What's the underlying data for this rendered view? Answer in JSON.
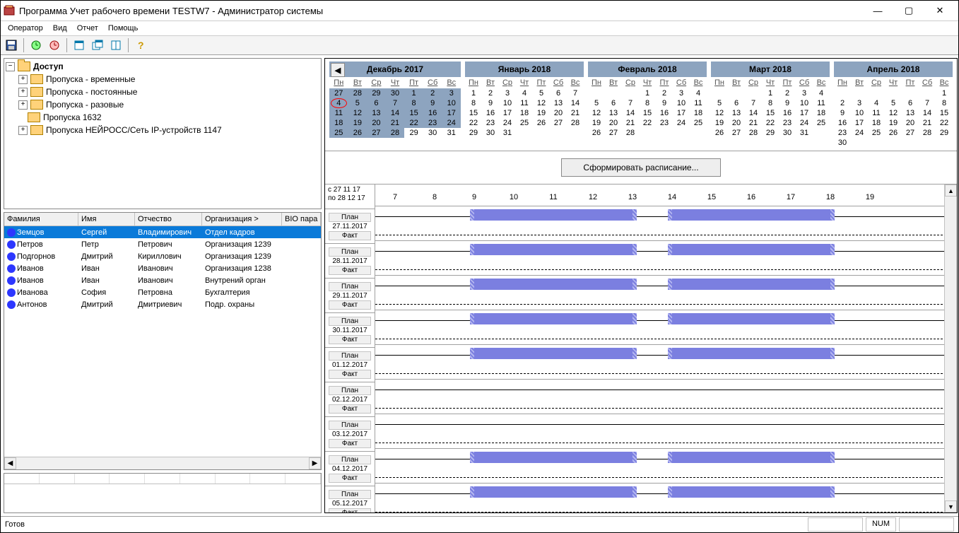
{
  "window": {
    "title": "Программа Учет рабочего времени TESTW7 - Администратор системы"
  },
  "menu": {
    "items": [
      "Оператор",
      "Вид",
      "Отчет",
      "Помощь"
    ]
  },
  "tree": {
    "root": "Доступ",
    "items": [
      "Пропуска - временные",
      "Пропуска - постоянные",
      "Пропуска - разовые",
      "Пропуска 1632",
      "Пропуска НЕЙРОСС/Сеть IP-устройств 1147"
    ]
  },
  "emp_table": {
    "cols": {
      "surname": "Фамилия",
      "name": "Имя",
      "patr": "Отчество",
      "org": "Организация >",
      "bio": "BIO пара"
    },
    "rows": [
      {
        "s": "Земцов",
        "n": "Сергей",
        "p": "Владимирович",
        "o": "Отдел кадров",
        "sel": true
      },
      {
        "s": "Петров",
        "n": "Петр",
        "p": "Петрович",
        "o": "Организация 1239"
      },
      {
        "s": "Подгорнов",
        "n": "Дмитрий",
        "p": "Кириллович",
        "o": "Организация 1239"
      },
      {
        "s": "Иванов",
        "n": "Иван",
        "p": "Иванович",
        "o": "Организация 1238"
      },
      {
        "s": "Иванов",
        "n": "Иван",
        "p": "Иванович",
        "o": "Внутрений орган"
      },
      {
        "s": "Иванова",
        "n": "София",
        "p": "Петровна",
        "o": "Бухгалтерия"
      },
      {
        "s": "Антонов",
        "n": "Дмитрий",
        "p": "Дмитриевич",
        "o": "Подр. охраны"
      }
    ]
  },
  "dow": [
    "Пн",
    "Вт",
    "Ср",
    "Чт",
    "Пт",
    "Сб",
    "Вс"
  ],
  "calendars": [
    {
      "title": "Декабрь 2017",
      "first": true,
      "weeks": [
        [
          {
            "d": 27,
            "s": 1
          },
          {
            "d": 28,
            "s": 1
          },
          {
            "d": 29,
            "s": 1
          },
          {
            "d": 30,
            "s": 1
          },
          {
            "d": 1,
            "s": 1
          },
          {
            "d": 2,
            "s": 1
          },
          {
            "d": 3,
            "s": 1
          }
        ],
        [
          {
            "d": 4,
            "s": 1,
            "t": 1
          },
          {
            "d": 5,
            "s": 1
          },
          {
            "d": 6,
            "s": 1
          },
          {
            "d": 7,
            "s": 1
          },
          {
            "d": 8,
            "s": 1
          },
          {
            "d": 9,
            "s": 1
          },
          {
            "d": 10,
            "s": 1
          }
        ],
        [
          {
            "d": 11,
            "s": 1
          },
          {
            "d": 12,
            "s": 1
          },
          {
            "d": 13,
            "s": 1
          },
          {
            "d": 14,
            "s": 1
          },
          {
            "d": 15,
            "s": 1
          },
          {
            "d": 16,
            "s": 1
          },
          {
            "d": 17,
            "s": 1
          }
        ],
        [
          {
            "d": 18,
            "s": 1
          },
          {
            "d": 19,
            "s": 1
          },
          {
            "d": 20,
            "s": 1
          },
          {
            "d": 21,
            "s": 1
          },
          {
            "d": 22,
            "s": 1
          },
          {
            "d": 23,
            "s": 1
          },
          {
            "d": 24,
            "s": 1
          }
        ],
        [
          {
            "d": 25,
            "s": 1
          },
          {
            "d": 26,
            "s": 1
          },
          {
            "d": 27,
            "s": 1
          },
          {
            "d": 28,
            "s": 1
          },
          {
            "d": 29
          },
          {
            "d": 30
          },
          {
            "d": 31
          }
        ]
      ]
    },
    {
      "title": "Январь 2018",
      "weeks": [
        [
          {
            "d": 1
          },
          {
            "d": 2
          },
          {
            "d": 3
          },
          {
            "d": 4
          },
          {
            "d": 5
          },
          {
            "d": 6
          },
          {
            "d": 7
          }
        ],
        [
          {
            "d": 8
          },
          {
            "d": 9
          },
          {
            "d": 10
          },
          {
            "d": 11
          },
          {
            "d": 12
          },
          {
            "d": 13
          },
          {
            "d": 14
          }
        ],
        [
          {
            "d": 15
          },
          {
            "d": 16
          },
          {
            "d": 17
          },
          {
            "d": 18
          },
          {
            "d": 19
          },
          {
            "d": 20
          },
          {
            "d": 21
          }
        ],
        [
          {
            "d": 22
          },
          {
            "d": 23
          },
          {
            "d": 24
          },
          {
            "d": 25
          },
          {
            "d": 26
          },
          {
            "d": 27
          },
          {
            "d": 28
          }
        ],
        [
          {
            "d": 29
          },
          {
            "d": 30
          },
          {
            "d": 31
          },
          {
            "d": ""
          },
          {
            "d": ""
          },
          {
            "d": ""
          },
          {
            "d": ""
          }
        ]
      ]
    },
    {
      "title": "Февраль 2018",
      "weeks": [
        [
          {
            "d": ""
          },
          {
            "d": ""
          },
          {
            "d": ""
          },
          {
            "d": 1
          },
          {
            "d": 2
          },
          {
            "d": 3
          },
          {
            "d": 4
          }
        ],
        [
          {
            "d": 5
          },
          {
            "d": 6
          },
          {
            "d": 7
          },
          {
            "d": 8
          },
          {
            "d": 9
          },
          {
            "d": 10
          },
          {
            "d": 11
          }
        ],
        [
          {
            "d": 12
          },
          {
            "d": 13
          },
          {
            "d": 14
          },
          {
            "d": 15
          },
          {
            "d": 16
          },
          {
            "d": 17
          },
          {
            "d": 18
          }
        ],
        [
          {
            "d": 19
          },
          {
            "d": 20
          },
          {
            "d": 21
          },
          {
            "d": 22
          },
          {
            "d": 23
          },
          {
            "d": 24
          },
          {
            "d": 25
          }
        ],
        [
          {
            "d": 26
          },
          {
            "d": 27
          },
          {
            "d": 28
          },
          {
            "d": ""
          },
          {
            "d": ""
          },
          {
            "d": ""
          },
          {
            "d": ""
          }
        ]
      ]
    },
    {
      "title": "Март 2018",
      "weeks": [
        [
          {
            "d": ""
          },
          {
            "d": ""
          },
          {
            "d": ""
          },
          {
            "d": 1
          },
          {
            "d": 2
          },
          {
            "d": 3
          },
          {
            "d": 4
          }
        ],
        [
          {
            "d": 5
          },
          {
            "d": 6
          },
          {
            "d": 7
          },
          {
            "d": 8
          },
          {
            "d": 9
          },
          {
            "d": 10
          },
          {
            "d": 11
          }
        ],
        [
          {
            "d": 12
          },
          {
            "d": 13
          },
          {
            "d": 14
          },
          {
            "d": 15
          },
          {
            "d": 16
          },
          {
            "d": 17
          },
          {
            "d": 18
          }
        ],
        [
          {
            "d": 19
          },
          {
            "d": 20
          },
          {
            "d": 21
          },
          {
            "d": 22
          },
          {
            "d": 23
          },
          {
            "d": 24
          },
          {
            "d": 25
          }
        ],
        [
          {
            "d": 26
          },
          {
            "d": 27
          },
          {
            "d": 28
          },
          {
            "d": 29
          },
          {
            "d": 30
          },
          {
            "d": 31
          },
          {
            "d": ""
          }
        ]
      ]
    },
    {
      "title": "Апрель 2018",
      "weeks": [
        [
          {
            "d": ""
          },
          {
            "d": ""
          },
          {
            "d": ""
          },
          {
            "d": ""
          },
          {
            "d": ""
          },
          {
            "d": ""
          },
          {
            "d": 1
          }
        ],
        [
          {
            "d": 2
          },
          {
            "d": 3
          },
          {
            "d": 4
          },
          {
            "d": 5
          },
          {
            "d": 6
          },
          {
            "d": 7
          },
          {
            "d": 8
          }
        ],
        [
          {
            "d": 9
          },
          {
            "d": 10
          },
          {
            "d": 11
          },
          {
            "d": 12
          },
          {
            "d": 13
          },
          {
            "d": 14
          },
          {
            "d": 15
          }
        ],
        [
          {
            "d": 16
          },
          {
            "d": 17
          },
          {
            "d": 18
          },
          {
            "d": 19
          },
          {
            "d": 20
          },
          {
            "d": 21
          },
          {
            "d": 22
          }
        ],
        [
          {
            "d": 23
          },
          {
            "d": 24
          },
          {
            "d": 25
          },
          {
            "d": 26
          },
          {
            "d": 27
          },
          {
            "d": 28
          },
          {
            "d": 29
          }
        ],
        [
          {
            "d": 30
          },
          {
            "d": ""
          },
          {
            "d": ""
          },
          {
            "d": ""
          },
          {
            "d": ""
          },
          {
            "d": ""
          },
          {
            "d": ""
          }
        ]
      ]
    }
  ],
  "generate_btn": "Сформировать расписание...",
  "schedule": {
    "range1": "с 27 11 17",
    "range2": "по 28 12 17",
    "hours": [
      7,
      8,
      9,
      10,
      11,
      12,
      13,
      14,
      15,
      16,
      17,
      18,
      19
    ],
    "plan_label": "План",
    "fact_label": "Факт",
    "days": [
      {
        "date": "27.11.2017",
        "bars": [
          [
            9,
            13
          ],
          [
            14,
            18
          ]
        ]
      },
      {
        "date": "28.11.2017",
        "bars": [
          [
            9,
            13
          ],
          [
            14,
            18
          ]
        ]
      },
      {
        "date": "29.11.2017",
        "bars": [
          [
            9,
            13
          ],
          [
            14,
            18
          ]
        ]
      },
      {
        "date": "30.11.2017",
        "bars": [
          [
            9,
            13
          ],
          [
            14,
            18
          ]
        ]
      },
      {
        "date": "01.12.2017",
        "bars": [
          [
            9,
            13
          ],
          [
            14,
            18
          ]
        ]
      },
      {
        "date": "02.12.2017",
        "bars": []
      },
      {
        "date": "03.12.2017",
        "bars": []
      },
      {
        "date": "04.12.2017",
        "bars": [
          [
            9,
            13
          ],
          [
            14,
            18
          ]
        ]
      },
      {
        "date": "05.12.2017",
        "bars": [
          [
            9,
            13
          ],
          [
            14,
            18
          ]
        ]
      }
    ]
  },
  "status": {
    "ready": "Готов",
    "num": "NUM"
  }
}
